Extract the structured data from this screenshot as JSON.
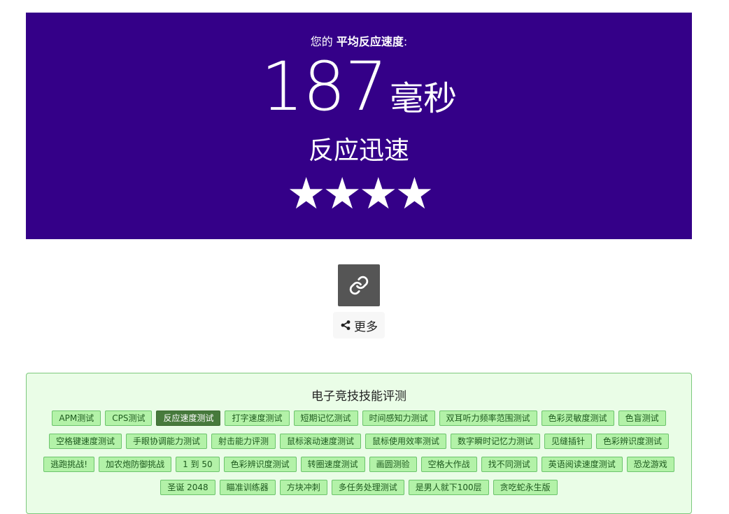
{
  "hero": {
    "intro_prefix": "您的",
    "intro_bold": "平均反应速度",
    "intro_suffix": ":",
    "score": "187",
    "unit": "毫秒",
    "verdict": "反应迅速",
    "stars": "★★★★",
    "rating_stars": 4,
    "background_color": "#340088"
  },
  "actions": {
    "link_icon": "link-icon",
    "more_label": "更多",
    "more_icon": "share-icon"
  },
  "tests": {
    "title": "电子竞技技能评测",
    "active_tag": "反应速度测试",
    "rows": [
      [
        "APM测试",
        "CPS测试",
        "反应速度测试",
        "打字速度测试",
        "短期记忆测试",
        "时间感知力测试",
        "双耳听力频率范围测试",
        "色彩灵敏度测试",
        "色盲测试"
      ],
      [
        "空格键速度测试",
        "手眼协调能力测试",
        "射击能力评测",
        "鼠标滚动速度测试",
        "鼠标使用效率测试",
        "数字瞬时记忆力测试",
        "见缝插针",
        "色彩辨识度测试"
      ],
      [
        "逃跑挑战!",
        "加农炮防御挑战",
        "1 到 50",
        "色彩辨识度测试",
        "转圈速度测试",
        "画圆测验",
        "空格大作战",
        "找不同测试",
        "英语阅读速度测试",
        "恐龙游戏"
      ],
      [
        "圣诞 2048",
        "瞄准训练器",
        "方块冲刺",
        "多任务处理测试",
        "是男人就下100层",
        "贪吃蛇永生版"
      ]
    ]
  }
}
